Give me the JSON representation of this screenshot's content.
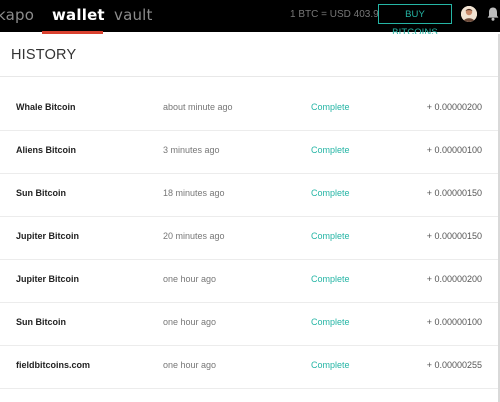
{
  "nav": {
    "items": [
      {
        "label": "kapo"
      },
      {
        "label": "wallet"
      },
      {
        "label": "vault"
      }
    ],
    "active": "wallet"
  },
  "header": {
    "rate_text": "1 BTC = USD 403.9",
    "buy_label": "BUY BITCOINS",
    "avatar_icon": "user-avatar-icon",
    "bell_icon": "bell-icon",
    "accent_color": "#25b5a5",
    "active_tab_color": "#d9412f"
  },
  "history": {
    "title": "HISTORY",
    "rows": [
      {
        "name": "Whale Bitcoin",
        "time": "about minute ago",
        "status": "Complete",
        "amount": "+ 0.00000200"
      },
      {
        "name": "Aliens Bitcoin",
        "time": "3 minutes ago",
        "status": "Complete",
        "amount": "+ 0.00000100"
      },
      {
        "name": "Sun Bitcoin",
        "time": "18 minutes ago",
        "status": "Complete",
        "amount": "+ 0.00000150"
      },
      {
        "name": "Jupiter Bitcoin",
        "time": "20 minutes ago",
        "status": "Complete",
        "amount": "+ 0.00000150"
      },
      {
        "name": "Jupiter Bitcoin",
        "time": "one hour ago",
        "status": "Complete",
        "amount": "+ 0.00000200"
      },
      {
        "name": "Sun Bitcoin",
        "time": "one hour ago",
        "status": "Complete",
        "amount": "+ 0.00000100"
      },
      {
        "name": "fieldbitcoins.com",
        "time": "one hour ago",
        "status": "Complete",
        "amount": "+ 0.00000255"
      }
    ]
  }
}
